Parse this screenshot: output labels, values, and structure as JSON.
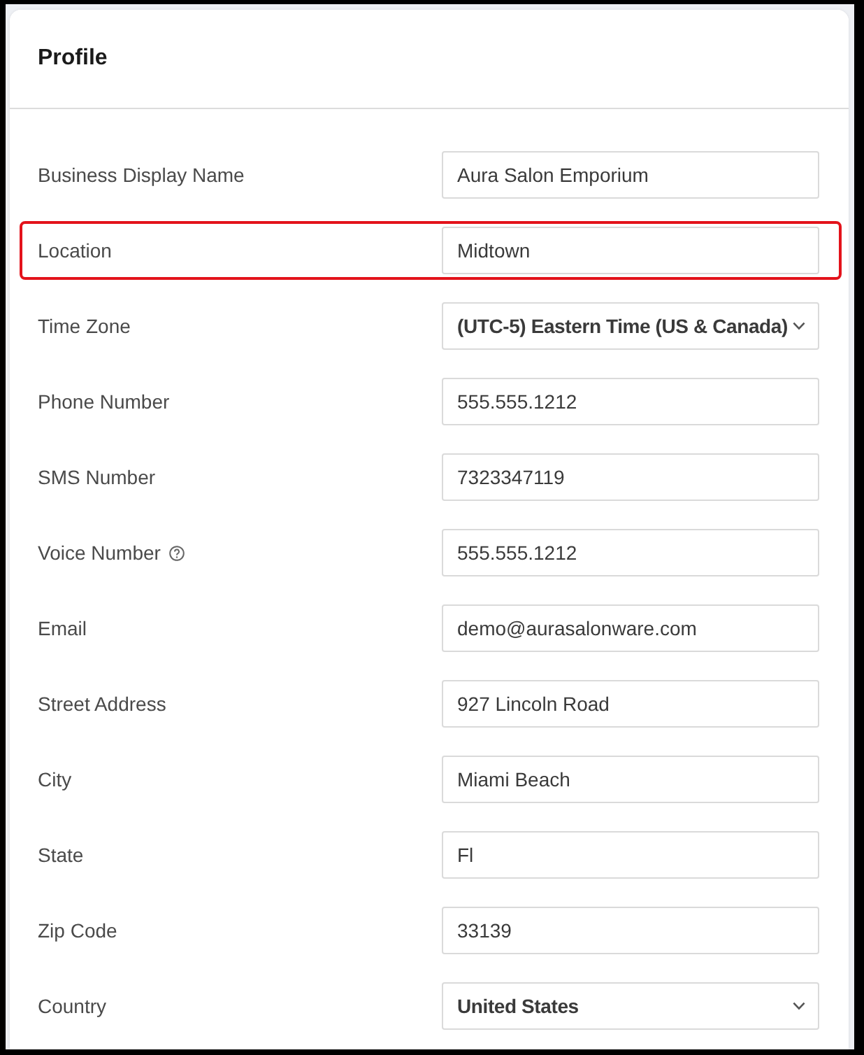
{
  "card": {
    "title": "Profile"
  },
  "fields": [
    {
      "label": "Business Display Name",
      "kind": "text",
      "value": "Aura Salon Emporium",
      "highlighted": false,
      "help_icon": false
    },
    {
      "label": "Location",
      "kind": "text",
      "value": "Midtown",
      "highlighted": true,
      "help_icon": false
    },
    {
      "label": "Time Zone",
      "kind": "select",
      "value": "(UTC-5) Eastern Time (US & Canada)",
      "highlighted": false,
      "help_icon": false
    },
    {
      "label": "Phone Number",
      "kind": "text",
      "value": "555.555.1212",
      "highlighted": false,
      "help_icon": false
    },
    {
      "label": "SMS Number",
      "kind": "text",
      "value": "7323347119",
      "highlighted": false,
      "help_icon": false
    },
    {
      "label": "Voice Number",
      "kind": "text",
      "value": "555.555.1212",
      "highlighted": false,
      "help_icon": true
    },
    {
      "label": "Email",
      "kind": "text",
      "value": "demo@aurasalonware.com",
      "highlighted": false,
      "help_icon": false
    },
    {
      "label": "Street Address",
      "kind": "text",
      "value": "927 Lincoln Road",
      "highlighted": false,
      "help_icon": false
    },
    {
      "label": "City",
      "kind": "text",
      "value": "Miami Beach",
      "highlighted": false,
      "help_icon": false
    },
    {
      "label": "State",
      "kind": "text",
      "value": "Fl",
      "highlighted": false,
      "help_icon": false
    },
    {
      "label": "Zip Code",
      "kind": "text",
      "value": "33139",
      "highlighted": false,
      "help_icon": false
    },
    {
      "label": "Country",
      "kind": "select",
      "value": "United States",
      "highlighted": false,
      "help_icon": false
    }
  ]
}
